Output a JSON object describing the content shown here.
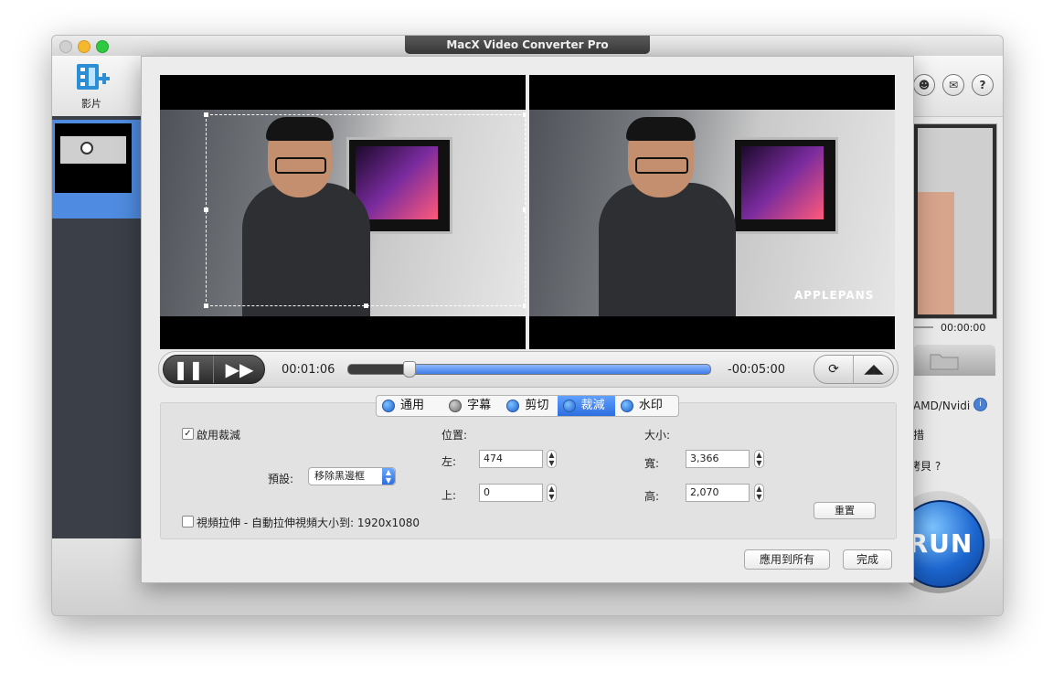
{
  "window": {
    "title": "MacX Video Converter Pro",
    "toolbar": {
      "add_video_label": "影片"
    },
    "right_panel": {
      "time": "00:00:00",
      "hw_accel_text": "AMD/Nvidi",
      "line2_text": "措",
      "line3_text": "拷貝 ?",
      "run_label": "RUN"
    }
  },
  "dialog": {
    "playback": {
      "current_time": "00:01:06",
      "remaining_time": "-00:05:00",
      "progress_percent": 17
    },
    "tabs": [
      {
        "label": "通用"
      },
      {
        "label": "字幕"
      },
      {
        "label": "剪切"
      },
      {
        "label": "裁減"
      },
      {
        "label": "水印"
      }
    ],
    "crop": {
      "enable_label": "啟用裁減",
      "enable_checked": true,
      "preset_label": "預設:",
      "preset_value": "移除黑邊框",
      "stretch_label": "視頻拉伸 - 自動拉伸視頻大小到:  1920x1080",
      "stretch_checked": false,
      "position_label": "位置:",
      "left_label": "左:",
      "left_value": "474",
      "top_label": "上:",
      "top_value": "0",
      "size_label": "大小:",
      "width_label": "寬:",
      "width_value": "3,366",
      "height_label": "高:",
      "height_value": "2,070",
      "reset_label": "重置"
    },
    "watermark_text": "APPLEPANS",
    "apply_all_label": "應用到所有",
    "done_label": "完成"
  },
  "colors": {
    "accent": "#2d6ee0",
    "run": "#1c66cf"
  }
}
